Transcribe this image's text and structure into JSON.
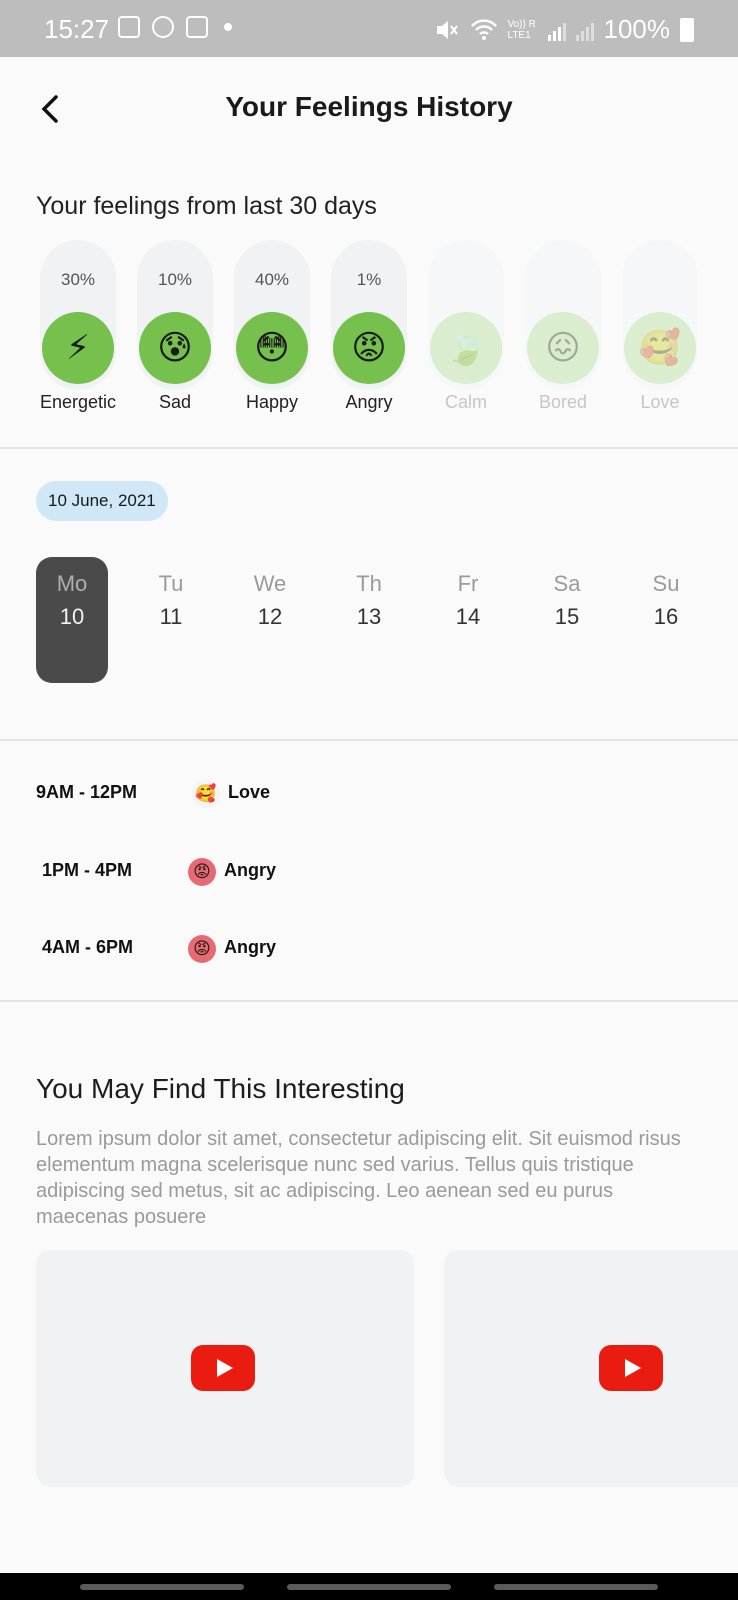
{
  "status_bar": {
    "time": "15:27",
    "battery": "100%",
    "network_label": "Vo)) R LTE1"
  },
  "header": {
    "title": "Your Feelings History",
    "back_icon": "chevron-left-icon"
  },
  "feelings": {
    "heading": "Your feelings from last 30 days",
    "accent_color": "#76c04e",
    "items": [
      {
        "label": "Energetic",
        "percent": "30%",
        "emoji": "⚡",
        "active": true
      },
      {
        "label": "Sad",
        "percent": "10%",
        "emoji": "😰",
        "active": true
      },
      {
        "label": "Happy",
        "percent": "40%",
        "emoji": "😳",
        "active": true
      },
      {
        "label": "Angry",
        "percent": "1%",
        "emoji": "😡",
        "active": true
      },
      {
        "label": "Calm",
        "percent": "",
        "emoji": "🍃",
        "active": false
      },
      {
        "label": "Bored",
        "percent": "",
        "emoji": "😖",
        "active": false
      },
      {
        "label": "Love",
        "percent": "",
        "emoji": "🥰",
        "active": false
      }
    ]
  },
  "date_chip": "10 June, 2021",
  "week": {
    "selected_index": 0,
    "days": [
      {
        "name": "Mo",
        "num": "10"
      },
      {
        "name": "Tu",
        "num": "11"
      },
      {
        "name": "We",
        "num": "12"
      },
      {
        "name": "Th",
        "num": "13"
      },
      {
        "name": "Fr",
        "num": "14"
      },
      {
        "name": "Sa",
        "num": "15"
      },
      {
        "name": "Su",
        "num": "16"
      }
    ]
  },
  "entries": [
    {
      "time": "9AM - 12PM",
      "emoji": "🥰",
      "mood": "Love"
    },
    {
      "time": "1PM - 4PM",
      "emoji": "😡",
      "mood": "Angry"
    },
    {
      "time": "4AM - 6PM",
      "emoji": "😡",
      "mood": "Angry"
    }
  ],
  "interesting": {
    "title": "You May Find This Interesting",
    "body": "Lorem ipsum dolor sit amet, consectetur adipiscing elit. Sit euismod risus elementum magna scelerisque nunc sed varius. Tellus quis tristique adipiscing sed metus, sit ac adipiscing. Leo aenean sed eu purus maecenas posuere",
    "video_icon": "youtube-play-icon",
    "video_color": "#ea1b11"
  }
}
